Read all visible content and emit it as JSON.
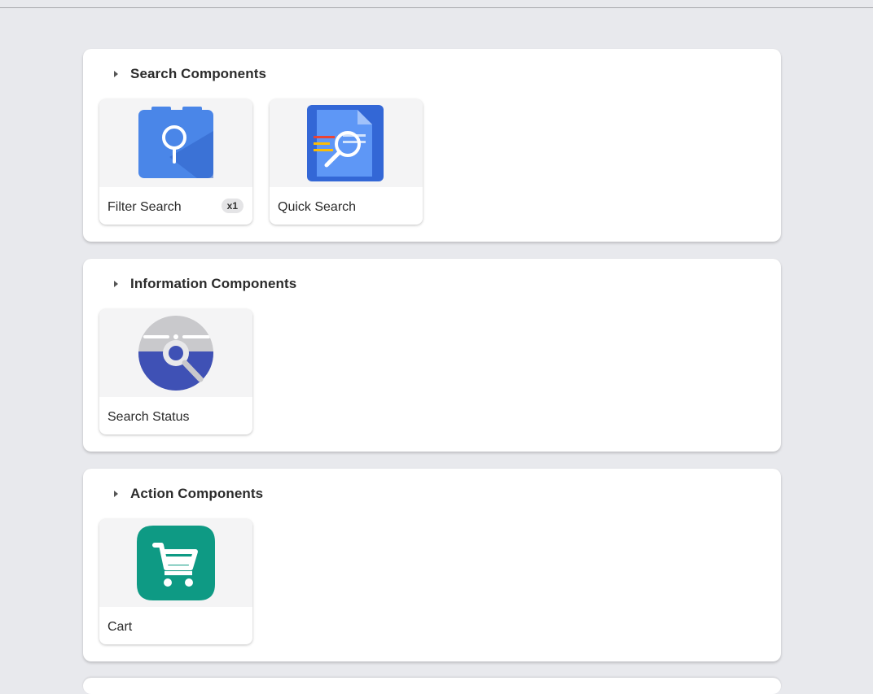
{
  "sections": [
    {
      "title": "Search Components",
      "items": [
        {
          "label": "Filter Search",
          "badge": "x1",
          "icon": "filter-search-icon"
        },
        {
          "label": "Quick Search",
          "badge": "",
          "icon": "quick-search-icon"
        }
      ]
    },
    {
      "title": "Information Components",
      "items": [
        {
          "label": "Search Status",
          "badge": "",
          "icon": "search-status-icon"
        }
      ]
    },
    {
      "title": "Action Components",
      "items": [
        {
          "label": "Cart",
          "badge": "",
          "icon": "cart-icon"
        }
      ]
    }
  ],
  "colors": {
    "background": "#e8e9ed",
    "panel": "#ffffff",
    "filter_blue": "#4a86e8",
    "quick_search_blue": "#3367d6",
    "status_blue": "#3f51b5",
    "cart_green": "#0e9a84"
  }
}
